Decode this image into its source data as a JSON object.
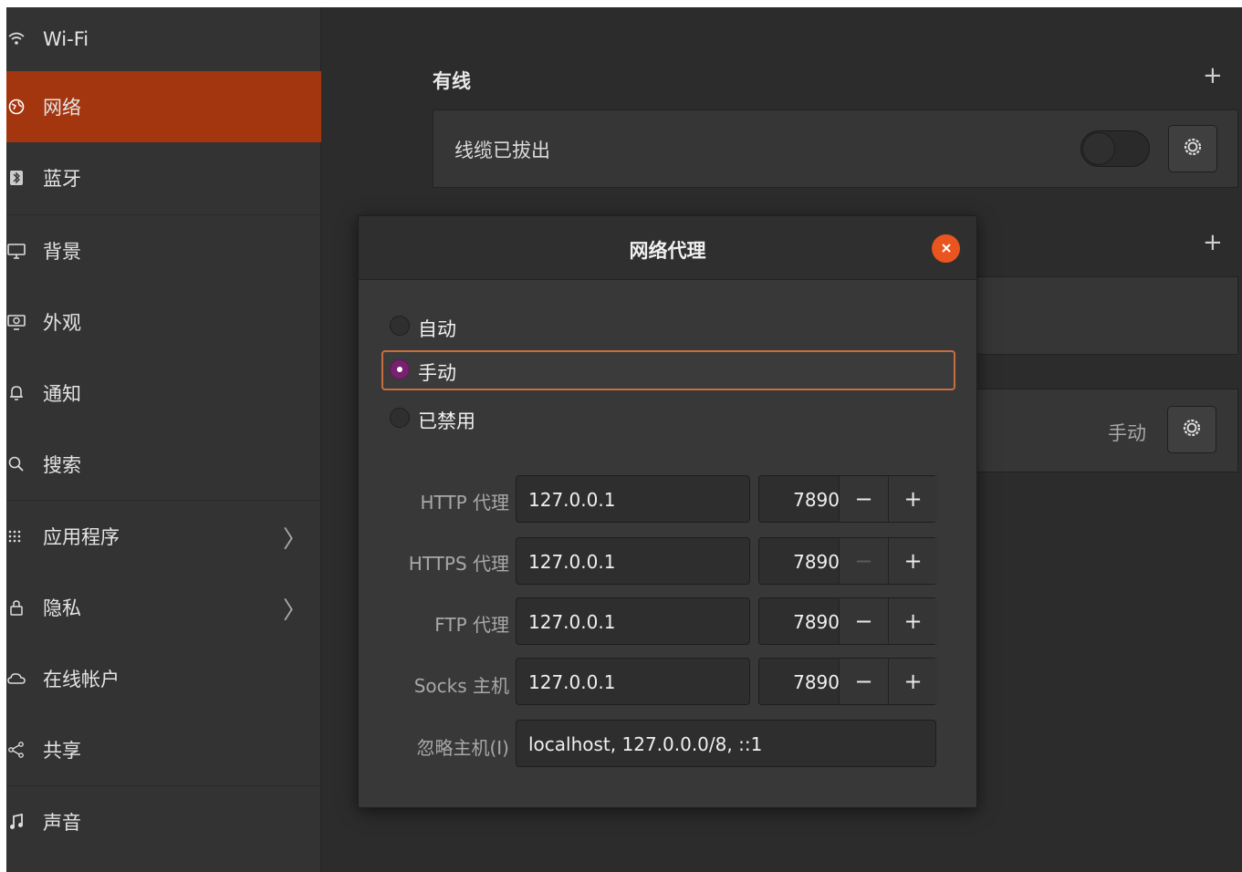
{
  "sidebar": {
    "items": [
      {
        "label": "Wi-Fi",
        "icon": "wifi-icon"
      },
      {
        "label": "网络",
        "icon": "globe-icon",
        "active": true
      },
      {
        "label": "蓝牙",
        "icon": "bluetooth-icon"
      },
      {
        "label": "背景",
        "icon": "monitor-icon"
      },
      {
        "label": "外观",
        "icon": "appearance-icon"
      },
      {
        "label": "通知",
        "icon": "bell-icon"
      },
      {
        "label": "搜索",
        "icon": "search-icon"
      },
      {
        "label": "应用程序",
        "icon": "apps-grid-icon",
        "chevron": "〉"
      },
      {
        "label": "隐私",
        "icon": "lock-icon",
        "chevron": "〉"
      },
      {
        "label": "在线帐户",
        "icon": "cloud-icon"
      },
      {
        "label": "共享",
        "icon": "share-icon"
      },
      {
        "label": "声音",
        "icon": "music-note-icon"
      }
    ],
    "active_color": "#a3360f"
  },
  "main": {
    "wired_title": "有线",
    "add_symbol": "+",
    "wired_status": "线缆已拔出",
    "wired_toggle_on": false,
    "proxy_mode": "手动"
  },
  "dialog": {
    "title": "网络代理",
    "close_icon": "close-icon",
    "radios": [
      {
        "label": "自动",
        "checked": false
      },
      {
        "label": "手动",
        "checked": true
      },
      {
        "label": "已禁用",
        "checked": false
      }
    ],
    "fields": [
      {
        "label": "HTTP 代理",
        "host": "127.0.0.1",
        "port": "7890",
        "minus_enabled": true
      },
      {
        "label": "HTTPS 代理",
        "host": "127.0.0.1",
        "port": "7890",
        "minus_enabled": false
      },
      {
        "label": "FTP 代理",
        "host": "127.0.0.1",
        "port": "7890",
        "minus_enabled": true
      },
      {
        "label": "Socks 主机",
        "host": "127.0.0.1",
        "port": "7890",
        "minus_enabled": true
      }
    ],
    "ignore_label": "忽略主机(I)",
    "ignore_value": "localhost, 127.0.0.0/8, ::1",
    "minus_symbol": "−",
    "plus_symbol": "+",
    "accent_color": "#e9541f",
    "radio_checked_color": "#77216f"
  }
}
